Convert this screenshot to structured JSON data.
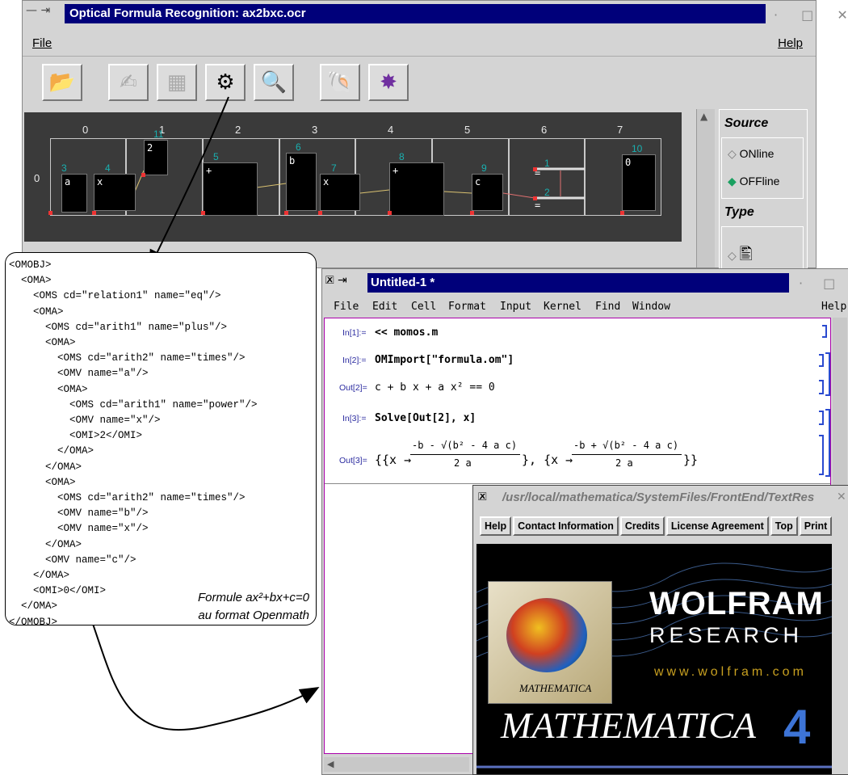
{
  "ocr_window": {
    "title": "Optical Formula Recognition: ax2bxc.ocr",
    "menu": {
      "file": "File",
      "help": "Help"
    },
    "toolbar": [
      {
        "name": "open-folder",
        "icon": "folder-icon",
        "enabled": true
      },
      {
        "name": "handwriting",
        "icon": "handwriting-icon",
        "enabled": false
      },
      {
        "name": "scan-image",
        "icon": "scan-icon",
        "enabled": false
      },
      {
        "name": "recognize",
        "icon": "recognize-icon",
        "enabled": true
      },
      {
        "name": "lens",
        "icon": "lens-icon",
        "enabled": false
      },
      {
        "name": "shell",
        "icon": "shell-icon",
        "enabled": true
      },
      {
        "name": "polyhedron",
        "icon": "polyhedron-icon",
        "enabled": true
      }
    ],
    "columns": [
      "0",
      "1",
      "2",
      "3",
      "4",
      "5",
      "6",
      "7"
    ],
    "row_label": "0",
    "symbols": [
      {
        "id": "3",
        "glyph": "a"
      },
      {
        "id": "4",
        "glyph": "x"
      },
      {
        "id": "11",
        "glyph": "2"
      },
      {
        "id": "5",
        "glyph": "+"
      },
      {
        "id": "6",
        "glyph": "b"
      },
      {
        "id": "7",
        "glyph": "x"
      },
      {
        "id": "8",
        "glyph": "+"
      },
      {
        "id": "9",
        "glyph": "c"
      },
      {
        "id": "1",
        "glyph": "="
      },
      {
        "id": "2",
        "glyph": "="
      },
      {
        "id": "10",
        "glyph": "0"
      }
    ],
    "side_panel": {
      "source_label": "Source",
      "online": "ONline",
      "offline": "OFFline",
      "type_label": "Type"
    }
  },
  "openmath": {
    "lines": [
      "<OMOBJ>",
      "  <OMA>",
      "    <OMS cd=\"relation1\" name=\"eq\"/>",
      "    <OMA>",
      "      <OMS cd=\"arith1\" name=\"plus\"/>",
      "      <OMA>",
      "        <OMS cd=\"arith2\" name=\"times\"/>",
      "        <OMV name=\"a\"/>",
      "        <OMA>",
      "          <OMS cd=\"arith1\" name=\"power\"/>",
      "          <OMV name=\"x\"/>",
      "          <OMI>2</OMI>",
      "        </OMA>",
      "      </OMA>",
      "      <OMA>",
      "        <OMS cd=\"arith2\" name=\"times\"/>",
      "        <OMV name=\"b\"/>",
      "        <OMV name=\"x\"/>",
      "      </OMA>",
      "      <OMV name=\"c\"/>",
      "    </OMA>",
      "    <OMI>0</OMI>",
      "  </OMA>",
      "</OMOBJ>"
    ],
    "caption_line1": "Formule ax²+bx+c=0",
    "caption_line2": "au format Openmath"
  },
  "notebook": {
    "title": "Untitled-1 *",
    "menu": [
      "File",
      "Edit",
      "Cell",
      "Format",
      "Input",
      "Kernel",
      "Find",
      "Window",
      "Help"
    ],
    "cells": {
      "in1_label": "In[1]:=",
      "in1_code": "<< momos.m",
      "in2_label": "In[2]:=",
      "in2_code": "OMImport[\"formula.om\"]",
      "out2_label": "Out[2]=",
      "out2_expr": "c + b x + a x² == 0",
      "in3_label": "In[3]:=",
      "in3_code": "Solve[Out[2], x]",
      "out3_label": "Out[3]=",
      "out3_open": "{{x →",
      "out3_num1": "-b - √(b² - 4 a c)",
      "out3_den1": "2 a",
      "out3_mid": "}, {x →",
      "out3_num2": "-b + √(b² - 4 a c)",
      "out3_den2": "2 a",
      "out3_close": "}}"
    }
  },
  "help_window": {
    "title": "/usr/local/mathematica/SystemFiles/FrontEnd/TextRes",
    "nav": [
      "Help",
      "Contact Information",
      "Credits",
      "License Agreement",
      "Top",
      "Print"
    ],
    "brand1": "WOLFRAM",
    "brand2": "RESEARCH",
    "url": "www.wolfram.com",
    "box_label": "MATHEMATICA",
    "product": "MATHEMATICA",
    "version": "4"
  },
  "colors": {
    "title_blue": "#00007a",
    "canvas_bg": "#3a3a3a",
    "id_cyan": "#19b0b0",
    "bracket_blue": "#2a4ad0",
    "version_blue": "#3d74d6"
  }
}
